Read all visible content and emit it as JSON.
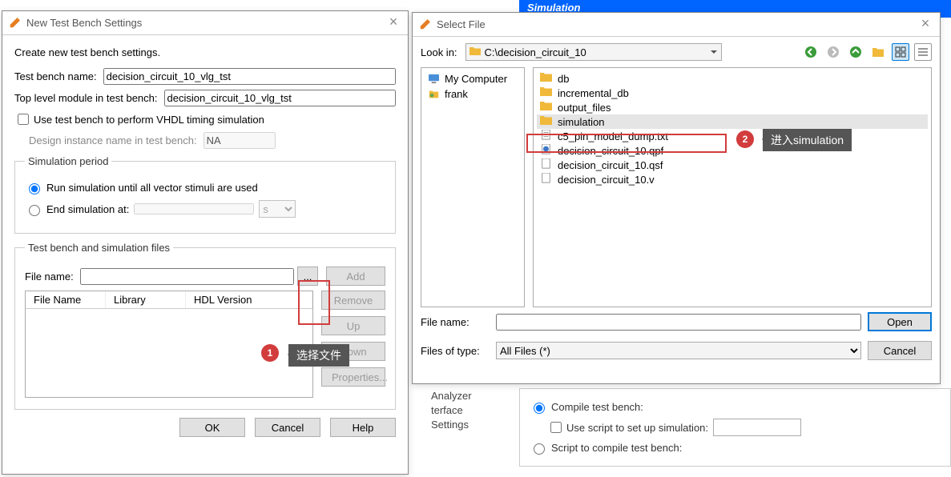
{
  "bg": {
    "tab": "Simulation",
    "side1": "Analyzer",
    "side2": "terface",
    "side3": "Settings",
    "r1": "Compile test bench:",
    "chk": "Use script to set up simulation:",
    "r2": "Script to compile test bench:"
  },
  "d1": {
    "title": "New Test Bench Settings",
    "intro": "Create new test bench settings.",
    "name_label": "Test bench name:",
    "name_val": "decision_circuit_10_vlg_tst",
    "top_label": "Top level module in test bench:",
    "top_val": "decision_circuit_10_vlg_tst",
    "vhdl": "Use test bench to perform VHDL timing simulation",
    "inst_label": "Design instance name in test bench:",
    "inst_val": "NA",
    "sim_legend": "Simulation period",
    "r1": "Run simulation until all vector stimuli are used",
    "r2": "End simulation at:",
    "unit": "s",
    "files_legend": "Test bench and simulation files",
    "fn_label": "File name:",
    "browse": "...",
    "add": "Add",
    "c1": "File Name",
    "c2": "Library",
    "c3": "HDL Version",
    "remove": "Remove",
    "up": "Up",
    "down": "Down",
    "props": "Properties...",
    "ok": "OK",
    "cancel": "Cancel",
    "help": "Help"
  },
  "d2": {
    "title": "Select File",
    "lookin_lbl": "Look in:",
    "lookin_val": "C:\\decision_circuit_10",
    "side": [
      {
        "icon": "computer",
        "label": "My Computer"
      },
      {
        "icon": "user",
        "label": "frank"
      }
    ],
    "files": [
      {
        "t": "folder",
        "n": "db"
      },
      {
        "t": "folder",
        "n": "incremental_db"
      },
      {
        "t": "folder",
        "n": "output_files"
      },
      {
        "t": "folder",
        "n": "simulation",
        "sel": true
      },
      {
        "t": "txt",
        "n": "c5_pin_model_dump.txt"
      },
      {
        "t": "qpf",
        "n": "decision_circuit_10.qpf"
      },
      {
        "t": "file",
        "n": "decision_circuit_10.qsf"
      },
      {
        "t": "file",
        "n": "decision_circuit_10.v"
      }
    ],
    "fn_label": "File name:",
    "ft_label": "Files of type:",
    "ft_val": "All Files (*)",
    "open": "Open",
    "cancel": "Cancel"
  },
  "annot": {
    "tip1": "选择文件",
    "tip2": "进入simulation"
  }
}
